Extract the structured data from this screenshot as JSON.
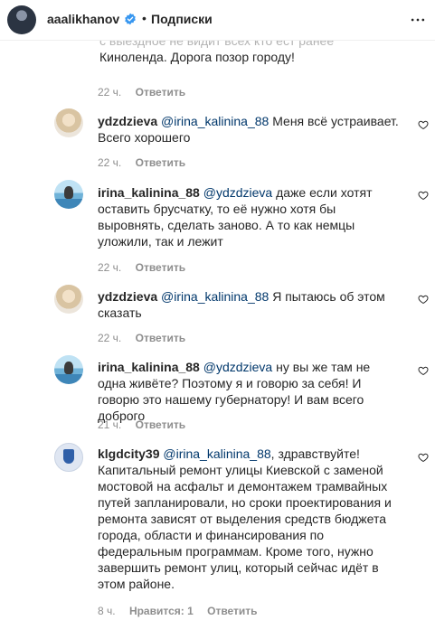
{
  "header": {
    "username": "aaalikhanov",
    "separator": "•",
    "follow_status": "Подписки"
  },
  "truncated_comment": {
    "hidden_line": "с выездное не видит всех кто ест ранее",
    "text": "Киноленда. Дорога позор городу!",
    "time": "22 ч.",
    "reply": "Ответить"
  },
  "comments": [
    {
      "username": "ydzdzieva",
      "mention": "@irina_kalinina_88",
      "text": " Меня всё устраивает. Всего хорошего",
      "time": "22 ч.",
      "reply": "Ответить"
    },
    {
      "username": "irina_kalinina_88",
      "mention": "@ydzdzieva",
      "text": " даже если хотят оставить брусчатку, то её нужно хотя бы выровнять, сделать заново. А то как немцы уложили, так и лежит",
      "time": "22 ч.",
      "reply": "Ответить"
    },
    {
      "username": "ydzdzieva",
      "mention": "@irina_kalinina_88",
      "text": " Я пытаюсь об этом сказать",
      "time": "22 ч.",
      "reply": "Ответить"
    },
    {
      "username": "irina_kalinina_88",
      "mention": "@ydzdzieva",
      "text": " ну вы же там не одна живёте? Поэтому я и говорю за себя! И говорю это нашему губернатору! И вам всего доброго",
      "time": "21 ч.",
      "reply": "Ответить"
    },
    {
      "username": "klgdcity39",
      "mention": "@irina_kalinina_88",
      "text": ", здравствуйте! Капитальный ремонт улицы Киевской с заменой мостовой на асфальт и демонтажем трамвайных путей запланировали, но сроки проектирования и ремонта зависят от выделения средств бюджета города, области и финансирования по федеральным программам. Кроме того, нужно завершить ремонт улиц, который сейчас идёт в этом районе.",
      "time": "8 ч.",
      "likes": "Нравится: 1",
      "reply": "Ответить"
    }
  ]
}
